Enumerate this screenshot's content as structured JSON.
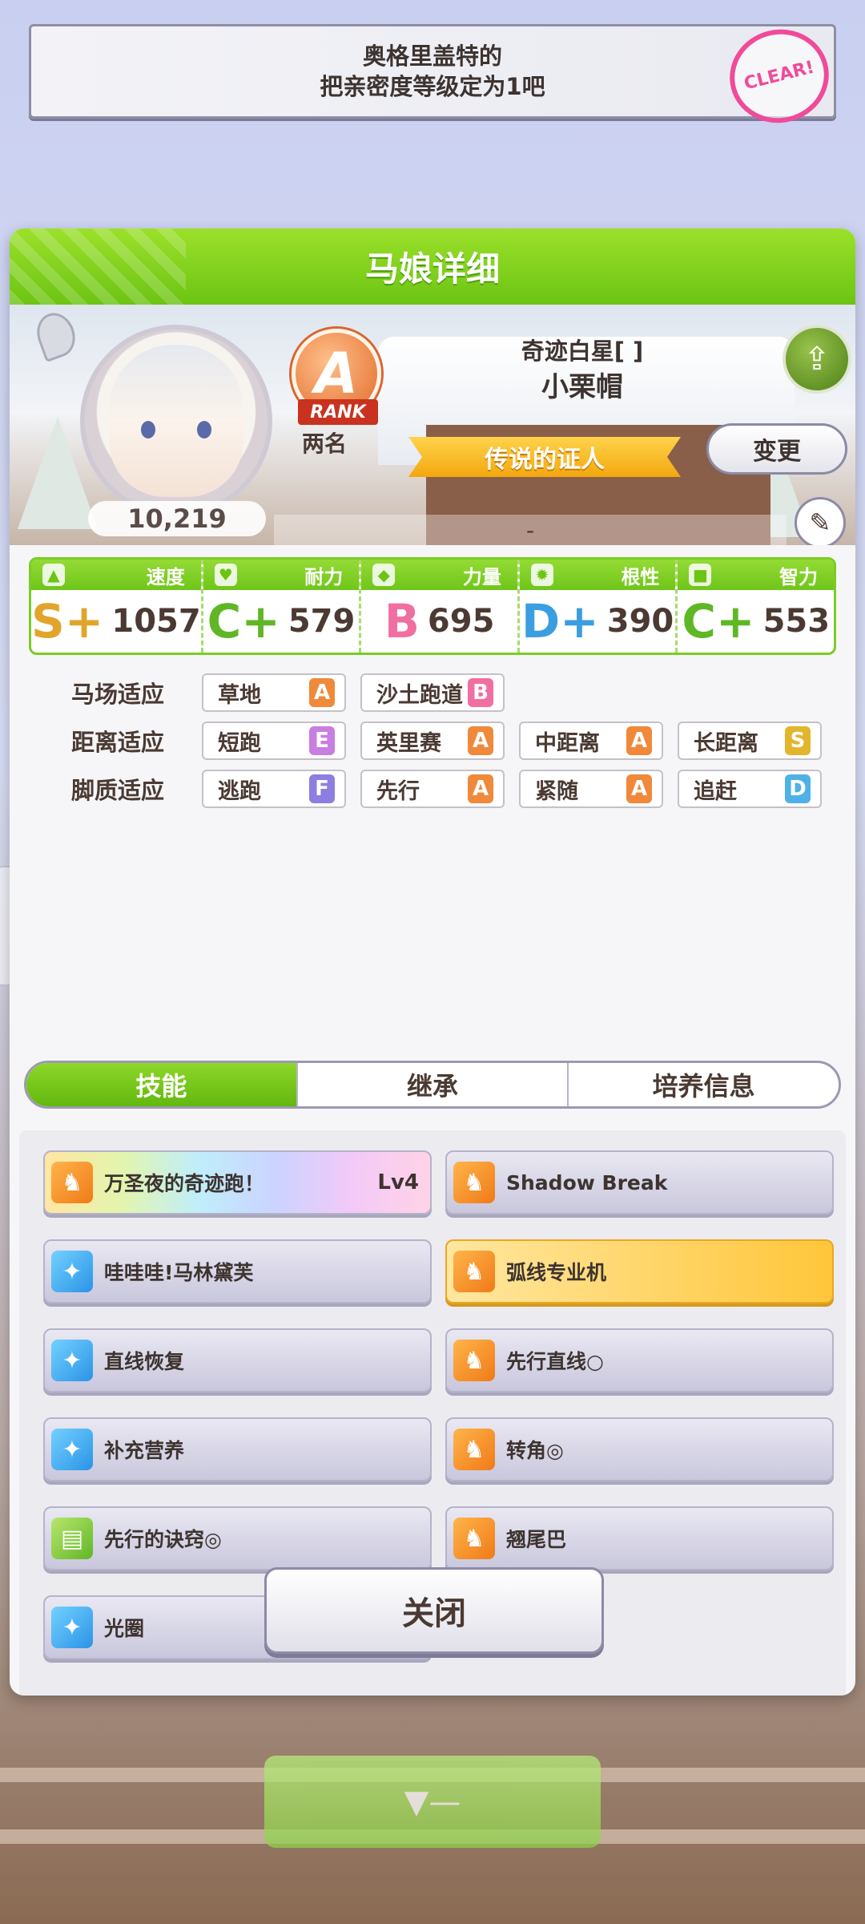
{
  "notice": {
    "line1": "奥格里盖特的",
    "line2": "把亲密度等级定为1吧",
    "stamp": "CLEAR!"
  },
  "modal": {
    "title": "马娘详细",
    "character": {
      "fans": "10,219",
      "rank_letter": "A",
      "rank_label": "RANK",
      "place": "两名",
      "title": "奇迹白星[ ]",
      "name": "小栗帽",
      "epithet": "传说的证人",
      "change_label": "变更",
      "share_icon": "share-icon",
      "edit_icon": "pencil-icon",
      "memo": "-"
    },
    "stats": [
      {
        "label": "速度",
        "icon": "shoe-icon",
        "grade": "S+",
        "value": "1057",
        "color": "#e2a52b"
      },
      {
        "label": "耐力",
        "icon": "heart-icon",
        "grade": "C+",
        "value": "579",
        "color": "#5fb725"
      },
      {
        "label": "力量",
        "icon": "muscle-icon",
        "grade": "B",
        "value": "695",
        "color": "#f06fa0"
      },
      {
        "label": "根性",
        "icon": "flame-icon",
        "grade": "D+",
        "value": "390",
        "color": "#3a9ee0"
      },
      {
        "label": "智力",
        "icon": "cap-icon",
        "grade": "C+",
        "value": "553",
        "color": "#5fb725"
      }
    ],
    "aptitude": {
      "track": {
        "label": "马场适应",
        "items": [
          {
            "name": "草地",
            "grade": "A"
          },
          {
            "name": "沙土跑道",
            "grade": "B"
          }
        ]
      },
      "distance": {
        "label": "距离适应",
        "items": [
          {
            "name": "短跑",
            "grade": "E"
          },
          {
            "name": "英里赛",
            "grade": "A"
          },
          {
            "name": "中距离",
            "grade": "A"
          },
          {
            "name": "长距离",
            "grade": "S"
          }
        ]
      },
      "style": {
        "label": "脚质适应",
        "items": [
          {
            "name": "逃跑",
            "grade": "F"
          },
          {
            "name": "先行",
            "grade": "A"
          },
          {
            "name": "紧随",
            "grade": "A"
          },
          {
            "name": "追赶",
            "grade": "D"
          }
        ]
      }
    },
    "tabs": [
      "技能",
      "继承",
      "培养信息"
    ],
    "skills": [
      {
        "name": "万圣夜的奇迹跑！",
        "level": "Lv4",
        "icon": "orange",
        "style": "rainbow"
      },
      {
        "name": "Shadow Break",
        "level": "",
        "icon": "orange",
        "style": "normal"
      },
      {
        "name": "哇哇哇!马林黛芙",
        "level": "",
        "icon": "blue",
        "style": "normal"
      },
      {
        "name": "弧线专业机",
        "level": "",
        "icon": "orange",
        "style": "gold"
      },
      {
        "name": "直线恢复",
        "level": "",
        "icon": "blue",
        "style": "normal"
      },
      {
        "name": "先行直线○",
        "level": "",
        "icon": "orange",
        "style": "normal"
      },
      {
        "name": "补充营养",
        "level": "",
        "icon": "blue",
        "style": "normal"
      },
      {
        "name": "转角◎",
        "level": "",
        "icon": "orange",
        "style": "normal"
      },
      {
        "name": "先行的诀窍◎",
        "level": "",
        "icon": "green",
        "style": "normal"
      },
      {
        "name": "翘尾巴",
        "level": "",
        "icon": "orange",
        "style": "normal"
      },
      {
        "name": "光圈",
        "level": "",
        "icon": "blue",
        "style": "normal"
      }
    ],
    "close_label": "关闭"
  }
}
